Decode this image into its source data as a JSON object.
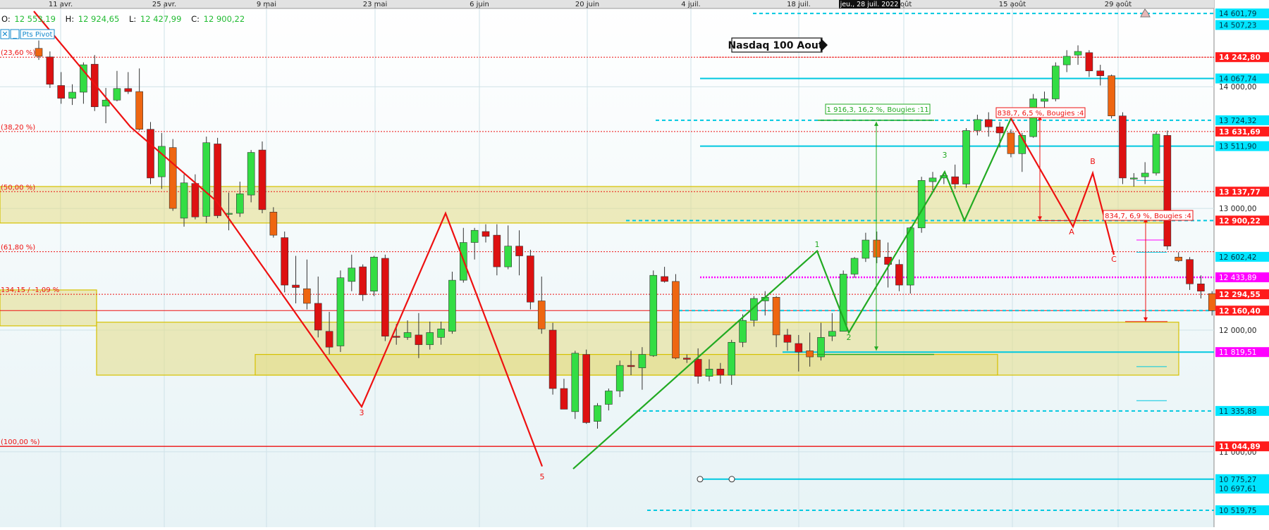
{
  "header": {
    "ohlc": [
      {
        "label": "O:",
        "value": "12 553,19"
      },
      {
        "label": "H:",
        "value": "12 924,65"
      },
      {
        "label": "L:",
        "value": "12 427,99"
      },
      {
        "label": "C:",
        "value": "12 900,22"
      }
    ],
    "close_icon": "close-icon",
    "pivot_label": "Pts Pivot",
    "crosshair_date": "jeu., 28 juil. 2022"
  },
  "chart_data": {
    "type": "candlestick",
    "title": "Nasdaq 100 Aout",
    "x_ticks": [
      "11 avr.",
      "25 avr.",
      "9 mai",
      "23 mai",
      "6 juin",
      "20 juin",
      "4 juil.",
      "18 juil.",
      "août",
      "15 août",
      "29 août"
    ],
    "ylim": [
      10450,
      14620
    ],
    "y_ticks": [
      "14 000,00",
      "13 000,00",
      "12 000,00",
      "11 000,00"
    ],
    "candles": [
      [
        14315,
        14380,
        14220,
        14250
      ],
      [
        14245,
        14290,
        13990,
        14020
      ],
      [
        14010,
        14120,
        13860,
        13905
      ],
      [
        13905,
        14020,
        13850,
        13955
      ],
      [
        13955,
        14200,
        13860,
        14180
      ],
      [
        14185,
        14260,
        13800,
        13835
      ],
      [
        13840,
        13990,
        13700,
        13890
      ],
      [
        13890,
        14130,
        13880,
        13985
      ],
      [
        13985,
        14120,
        13940,
        13960
      ],
      [
        13960,
        14150,
        13640,
        13650
      ],
      [
        13650,
        13710,
        13200,
        13250
      ],
      [
        13260,
        13620,
        13160,
        13510
      ],
      [
        13500,
        13570,
        12980,
        13000
      ],
      [
        12920,
        13280,
        12850,
        13210
      ],
      [
        13205,
        13280,
        12910,
        12930
      ],
      [
        12935,
        13590,
        12880,
        13540
      ],
      [
        13530,
        13580,
        12920,
        12940
      ],
      [
        12960,
        13130,
        12820,
        12960
      ],
      [
        12960,
        13220,
        12930,
        13120
      ],
      [
        13110,
        13480,
        13050,
        13460
      ],
      [
        13480,
        13550,
        12960,
        12990
      ],
      [
        12970,
        13010,
        12760,
        12780
      ],
      [
        12760,
        12810,
        12310,
        12370
      ],
      [
        12370,
        12610,
        12220,
        12350
      ],
      [
        12340,
        12580,
        12170,
        12220
      ],
      [
        12220,
        12440,
        11940,
        12000
      ],
      [
        11990,
        12150,
        11800,
        11860
      ],
      [
        11870,
        12490,
        11820,
        12430
      ],
      [
        12400,
        12620,
        12320,
        12510
      ],
      [
        12520,
        12540,
        12240,
        12290
      ],
      [
        12320,
        12610,
        12280,
        12600
      ],
      [
        12590,
        12620,
        11910,
        11950
      ],
      [
        11950,
        12050,
        11880,
        11940
      ],
      [
        11940,
        12080,
        11920,
        11980
      ],
      [
        11960,
        12140,
        11770,
        11880
      ],
      [
        11880,
        12070,
        11840,
        11980
      ],
      [
        11940,
        12070,
        11880,
        12010
      ],
      [
        11990,
        12480,
        11970,
        12410
      ],
      [
        12410,
        12840,
        12390,
        12720
      ],
      [
        12720,
        12840,
        12580,
        12820
      ],
      [
        12810,
        12870,
        12720,
        12770
      ],
      [
        12780,
        12870,
        12450,
        12520
      ],
      [
        12520,
        12860,
        12500,
        12690
      ],
      [
        12690,
        12820,
        12450,
        12610
      ],
      [
        12610,
        12660,
        12170,
        12230
      ],
      [
        12240,
        12440,
        11970,
        12010
      ],
      [
        12000,
        12060,
        11470,
        11520
      ],
      [
        11520,
        11600,
        11350,
        11350
      ],
      [
        11330,
        11830,
        11270,
        11810
      ],
      [
        11800,
        11840,
        11230,
        11240
      ],
      [
        11250,
        11400,
        11190,
        11380
      ],
      [
        11390,
        11520,
        11340,
        11500
      ],
      [
        11500,
        11750,
        11450,
        11710
      ],
      [
        11710,
        11830,
        11630,
        11700
      ],
      [
        11690,
        11860,
        11510,
        11800
      ],
      [
        11790,
        12490,
        11780,
        12450
      ],
      [
        12440,
        12520,
        12390,
        12400
      ],
      [
        12400,
        12460,
        11760,
        11770
      ],
      [
        11770,
        11800,
        11730,
        11760
      ],
      [
        11760,
        11850,
        11560,
        11620
      ],
      [
        11620,
        11760,
        11580,
        11680
      ],
      [
        11680,
        11730,
        11560,
        11630
      ],
      [
        11630,
        11920,
        11550,
        11900
      ],
      [
        11900,
        12130,
        11860,
        12080
      ],
      [
        12080,
        12280,
        12030,
        12260
      ],
      [
        12240,
        12320,
        12120,
        12270
      ],
      [
        12270,
        12280,
        11860,
        11960
      ],
      [
        11960,
        12010,
        11830,
        11900
      ],
      [
        11890,
        11960,
        11660,
        11820
      ],
      [
        11830,
        11980,
        11700,
        11780
      ],
      [
        11780,
        12060,
        11750,
        11940
      ],
      [
        11950,
        12140,
        11910,
        11990
      ],
      [
        11990,
        12490,
        11990,
        12460
      ],
      [
        12460,
        12600,
        12430,
        12590
      ],
      [
        12590,
        12800,
        12560,
        12740
      ],
      [
        12740,
        12810,
        12550,
        12600
      ],
      [
        12600,
        12720,
        12350,
        12540
      ],
      [
        12540,
        12580,
        12320,
        12370
      ],
      [
        12370,
        12850,
        12300,
        12840
      ],
      [
        12840,
        13260,
        12800,
        13230
      ],
      [
        13220,
        13300,
        13150,
        13250
      ],
      [
        13250,
        13300,
        13200,
        13270
      ],
      [
        13260,
        13360,
        13160,
        13200
      ],
      [
        13200,
        13660,
        13170,
        13640
      ],
      [
        13640,
        13770,
        13600,
        13730
      ],
      [
        13730,
        13790,
        13590,
        13670
      ],
      [
        13670,
        13710,
        13500,
        13620
      ],
      [
        13620,
        13650,
        13420,
        13450
      ],
      [
        13450,
        13620,
        13300,
        13600
      ],
      [
        13590,
        13940,
        13580,
        13900
      ],
      [
        13880,
        13960,
        13830,
        13900
      ],
      [
        13900,
        14200,
        13880,
        14170
      ],
      [
        14180,
        14300,
        14120,
        14250
      ],
      [
        14260,
        14340,
        14180,
        14290
      ],
      [
        14280,
        14300,
        14080,
        14130
      ],
      [
        14130,
        14180,
        14010,
        14090
      ],
      [
        14090,
        14100,
        13740,
        13760
      ],
      [
        13760,
        13790,
        13200,
        13250
      ],
      [
        13250,
        13290,
        13180,
        13250
      ],
      [
        13260,
        13380,
        13200,
        13290
      ],
      [
        13290,
        13630,
        13270,
        13610
      ],
      [
        13600,
        13640,
        12660,
        12690
      ],
      [
        12600,
        12640,
        12560,
        12570
      ],
      [
        12580,
        12600,
        12330,
        12380
      ],
      [
        12380,
        12450,
        12260,
        12320
      ],
      [
        12300,
        12320,
        12120,
        12160
      ]
    ],
    "fib_levels": [
      {
        "label": "(23,60 %)",
        "value": 14242.8
      },
      {
        "label": "(38,20 %)",
        "value": 13631.69
      },
      {
        "label": "(50,00 %)",
        "value": 13137.77
      },
      {
        "label": "(61,80 %)",
        "value": 12643.85
      },
      {
        "label": "(100,00 %)",
        "value": 11044.89
      },
      {
        "label": "134,15 / -1,09 %",
        "value": 12294.55
      }
    ],
    "price_labels": [
      {
        "text": "14 601,79",
        "value": 14601.79,
        "bg": "#00e5ff",
        "fg": "#003344"
      },
      {
        "text": "14 507,23",
        "value": 14507.23,
        "bg": "#00e5ff",
        "fg": "#003344"
      },
      {
        "text": "14 242,80",
        "value": 14242.8,
        "bg": "#ff1c1c",
        "fg": "#ffffff"
      },
      {
        "text": "14 067,74",
        "value": 14067.74,
        "bg": "#00e5ff",
        "fg": "#003344"
      },
      {
        "text": "13 724,32",
        "value": 13724.32,
        "bg": "#00e5ff",
        "fg": "#003344"
      },
      {
        "text": "13 631,69",
        "value": 13631.69,
        "bg": "#ff1c1c",
        "fg": "#ffffff"
      },
      {
        "text": "13 511,90",
        "value": 13511.9,
        "bg": "#00e5ff",
        "fg": "#003344"
      },
      {
        "text": "13 137,77",
        "value": 13137.77,
        "bg": "#ff1c1c",
        "fg": "#ffffff"
      },
      {
        "text": "12 900,22",
        "value": 12900.22,
        "bg": "#ff1c1c",
        "fg": "#ffffff"
      },
      {
        "text": "12 602,42",
        "value": 12602.42,
        "bg": "#00e5ff",
        "fg": "#003344"
      },
      {
        "text": "12 433,89",
        "value": 12433.89,
        "bg": "#ff00ff",
        "fg": "#ffffff"
      },
      {
        "text": "12 294,55",
        "value": 12294.55,
        "bg": "#ff1c1c",
        "fg": "#ffffff"
      },
      {
        "text": "12 160,40",
        "value": 12160.4,
        "bg": "#ff1c1c",
        "fg": "#ffffff"
      },
      {
        "text": "11 819,51",
        "value": 11819.51,
        "bg": "#ff00ff",
        "fg": "#ffffff"
      },
      {
        "text": "11 335,88",
        "value": 11335.88,
        "bg": "#00e5ff",
        "fg": "#003344"
      },
      {
        "text": "11 044,89",
        "value": 11044.89,
        "bg": "#ff1c1c",
        "fg": "#ffffff"
      },
      {
        "text": "10 775,27",
        "value": 10775.27,
        "bg": "#00e5ff",
        "fg": "#003344"
      },
      {
        "text": "10 697,61",
        "value": 10697.61,
        "bg": "#00e5ff",
        "fg": "#003344"
      },
      {
        "text": "10 519,75",
        "value": 10519.75,
        "bg": "#00e5ff",
        "fg": "#003344"
      }
    ],
    "annotations": {
      "wave_labels": [
        "1",
        "2",
        "3",
        "3",
        "5",
        "A",
        "B",
        "C"
      ],
      "measure_1": "1 916,3, 16,2 %, Bougies :11",
      "measure_2": "838,7, 6,5 %, Bougies :4",
      "measure_3": "834,7, 6,9 %, Bougies :4"
    },
    "colors": {
      "up": "#33dd44",
      "down": "#ee2222",
      "zone_fill": "#e3dc86",
      "zone_stroke": "#d6c100",
      "support": "#00c8e0",
      "pivot": "#ff00ff"
    },
    "grid": true
  }
}
